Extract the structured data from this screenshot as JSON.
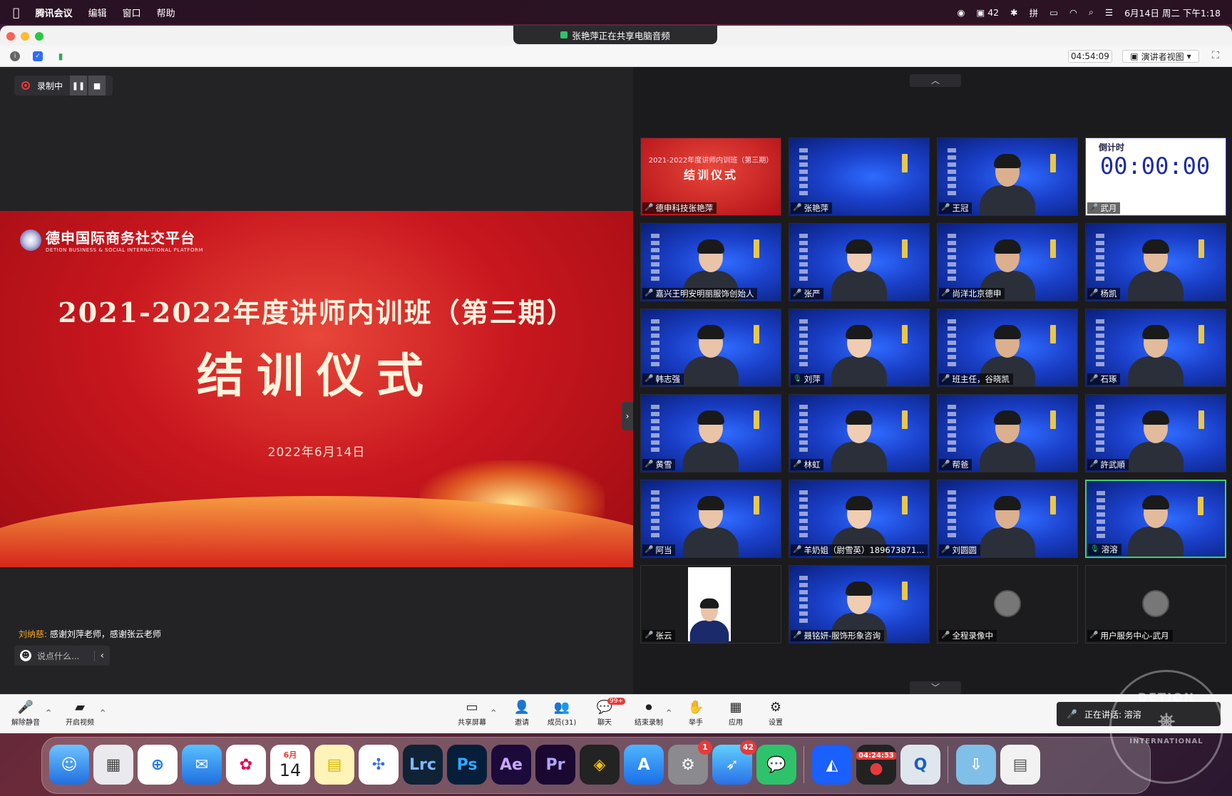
{
  "menubar": {
    "app_name": "腾讯会议",
    "menus": [
      "编辑",
      "窗口",
      "帮助"
    ],
    "battery_count": "42",
    "datetime": "6月14日 周二 下午1:18"
  },
  "window": {
    "sharing_banner": "张艳萍正在共享电脑音频",
    "elapsed": "04:54:09",
    "view_mode": "演讲者视图"
  },
  "recording": {
    "label": "录制中"
  },
  "slide": {
    "org_cn": "德申国际商务社交平台",
    "org_en": "DETION BUSINESS & SOCIAL INTERNATIONAL PLATFORM",
    "title": "2021-2022年度讲师内训班（第三期）",
    "subtitle": "结训仪式",
    "date": "2022年6月14日"
  },
  "chat": {
    "sender": "刘纳慈:",
    "message": " 感谢刘萍老师，感谢张云老师",
    "placeholder": "说点什么..."
  },
  "participants": [
    {
      "name": "德申科技张艳萍",
      "style": "red",
      "mic": "muted"
    },
    {
      "name": "张艳萍",
      "style": "blue-empty",
      "mic": "muted"
    },
    {
      "name": "王冠",
      "style": "blue",
      "mic": "muted"
    },
    {
      "name": "武月",
      "style": "timer",
      "mic": "muted"
    },
    {
      "name": "嘉兴王明安明丽服饰创始人",
      "style": "blue",
      "mic": "muted"
    },
    {
      "name": "张严",
      "style": "blue",
      "mic": "muted"
    },
    {
      "name": "尚洋北京德申",
      "style": "blue",
      "mic": "muted"
    },
    {
      "name": "杨凯",
      "style": "blue",
      "mic": "muted"
    },
    {
      "name": "韩志强",
      "style": "blue",
      "mic": "muted"
    },
    {
      "name": "刘萍",
      "style": "blue",
      "mic": "on"
    },
    {
      "name": "班主任，谷晓凯",
      "style": "blue",
      "mic": "muted"
    },
    {
      "name": "石琢",
      "style": "blue",
      "mic": "muted"
    },
    {
      "name": "黄雪",
      "style": "blue",
      "mic": "muted"
    },
    {
      "name": "林虹",
      "style": "blue",
      "mic": "muted"
    },
    {
      "name": "帮爸",
      "style": "blue",
      "mic": "muted"
    },
    {
      "name": "許武順",
      "style": "blue",
      "mic": "muted"
    },
    {
      "name": "阿当",
      "style": "blue",
      "mic": "muted"
    },
    {
      "name": "羊奶姐（尉雪英）189673871...",
      "style": "blue",
      "mic": "muted"
    },
    {
      "name": "刘圆圆",
      "style": "blue",
      "mic": "muted"
    },
    {
      "name": "溶溶",
      "style": "blue",
      "mic": "on",
      "active": true
    },
    {
      "name": "张云",
      "style": "dark-video",
      "mic": "muted"
    },
    {
      "name": "聂铭妍-服饰形象咨询",
      "style": "blue",
      "mic": "muted"
    },
    {
      "name": "全程录像中",
      "style": "dark-avatar",
      "mic": "muted"
    },
    {
      "name": "用户服务中心-武月",
      "style": "dark-avatar",
      "mic": "muted"
    }
  ],
  "red_tile": {
    "line1": "2021-2022年度讲师内训班（第三期）",
    "line2": "结训仪式"
  },
  "timer_tile": {
    "label": "倒计时",
    "value": "00:00:00"
  },
  "controls": {
    "unmute": "解除静音",
    "start_video": "开启视频",
    "share_screen": "共享屏幕",
    "invite": "邀请",
    "members": "成员(31)",
    "chat": "聊天",
    "chat_badge": "99+",
    "end_recording": "结束录制",
    "raise_hand": "举手",
    "apps": "应用",
    "settings": "设置",
    "speaking": "正在讲话: 溶溶"
  },
  "dock": {
    "calendar_month": "6月",
    "calendar_day": "14",
    "settings_badge": "1",
    "feishu_badge": "42",
    "recorder_time": "04:24:53",
    "apps": [
      "Lrc",
      "Ps",
      "Ae",
      "Pr"
    ]
  },
  "watermark": {
    "top": "DETION",
    "bottom": "INTERNATIONAL"
  }
}
